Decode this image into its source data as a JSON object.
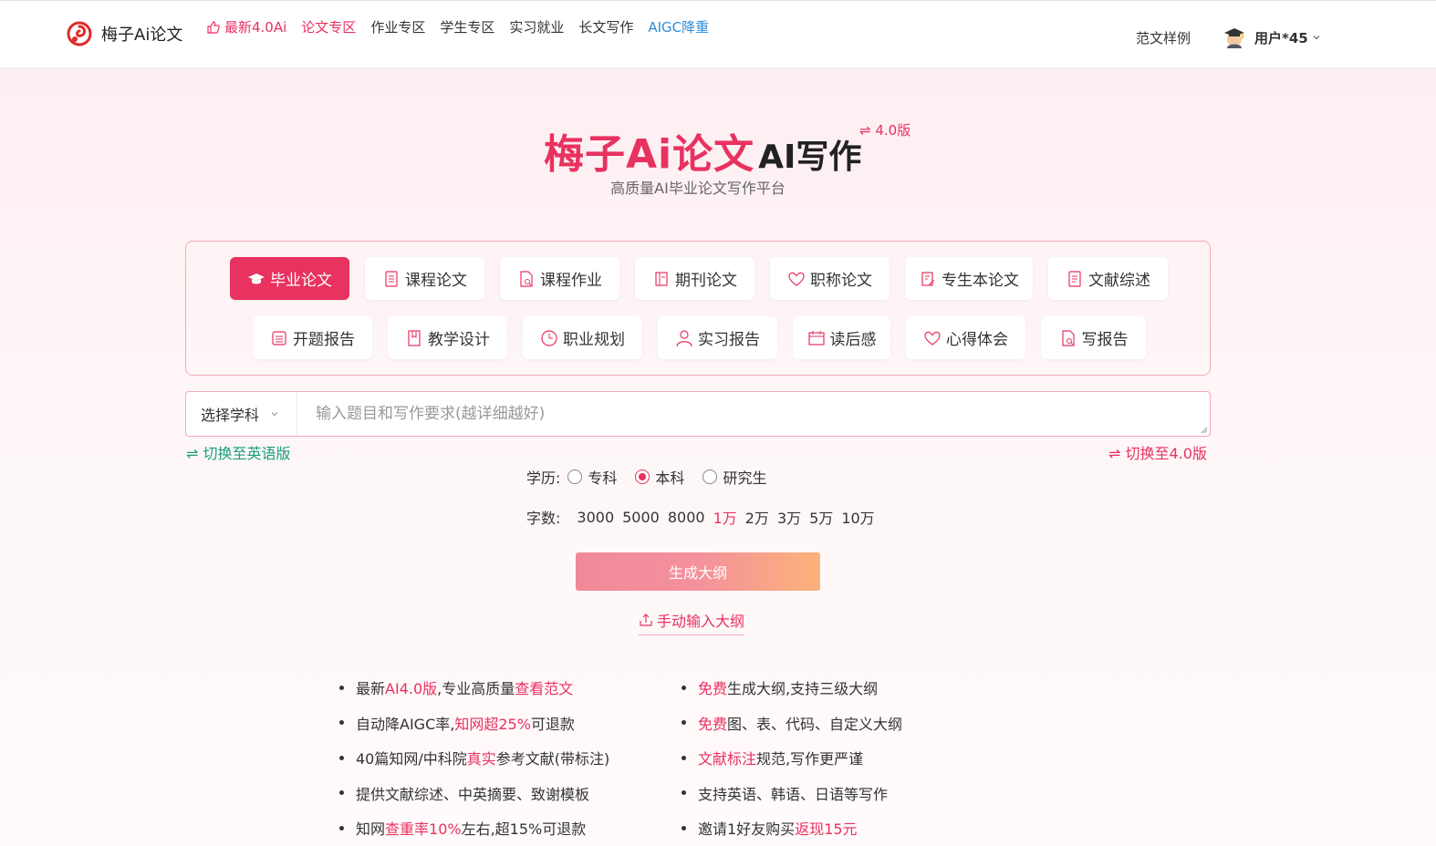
{
  "header": {
    "logo_text": "梅子Ai论文",
    "nav": [
      {
        "label": "最新4.0Ai",
        "style": "hot"
      },
      {
        "label": "论文专区",
        "style": "active"
      },
      {
        "label": "作业专区",
        "style": ""
      },
      {
        "label": "学生专区",
        "style": ""
      },
      {
        "label": "实习就业",
        "style": ""
      },
      {
        "label": "长文写作",
        "style": ""
      },
      {
        "label": "AIGC降重",
        "style": "aigc"
      }
    ],
    "sample_link": "范文样例",
    "user_name": "用户*45"
  },
  "hero": {
    "brand_pink": "梅子Ai论文",
    "brand_dark": "AI写作",
    "version_tag": "⇌ 4.0版",
    "subtitle": "高质量AI毕业论文写作平台"
  },
  "types": {
    "row1": [
      {
        "label": "毕业论文",
        "icon": "graduation-cap-icon",
        "selected": true
      },
      {
        "label": "课程论文",
        "icon": "document-icon"
      },
      {
        "label": "课程作业",
        "icon": "file-search-icon"
      },
      {
        "label": "期刊论文",
        "icon": "journal-icon"
      },
      {
        "label": "职称论文",
        "icon": "heart-icon"
      },
      {
        "label": "专生本论文",
        "icon": "file-edit-icon"
      },
      {
        "label": "文献综述",
        "icon": "document-icon"
      }
    ],
    "row2": [
      {
        "label": "开题报告",
        "icon": "report-icon"
      },
      {
        "label": "教学设计",
        "icon": "book-icon"
      },
      {
        "label": "职业规划",
        "icon": "clock-icon"
      },
      {
        "label": "实习报告",
        "icon": "person-icon"
      },
      {
        "label": "读后感",
        "icon": "calendar-icon"
      },
      {
        "label": "心得体会",
        "icon": "heart-icon"
      },
      {
        "label": "写报告",
        "icon": "file-search-icon"
      }
    ]
  },
  "input": {
    "subject_select": "选择学科",
    "placeholder": "输入题目和写作要求(越详细越好)",
    "value": ""
  },
  "switches": {
    "english": "⇌ 切换至英语版",
    "v40": "⇌ 切换至4.0版"
  },
  "education": {
    "label": "学历:",
    "options": [
      "专科",
      "本科",
      "研究生"
    ],
    "selected": "本科"
  },
  "word_count": {
    "label": "字数:",
    "options": [
      "3000",
      "5000",
      "8000",
      "1万",
      "2万",
      "3万",
      "5万",
      "10万"
    ],
    "selected": "1万"
  },
  "actions": {
    "generate": "生成大纲",
    "manual": "手动输入大纲"
  },
  "features": {
    "left": [
      [
        {
          "t": "最新",
          "h": false
        },
        {
          "t": "AI4.0版",
          "h": true
        },
        {
          "t": ",专业高质量 ",
          "h": false
        },
        {
          "t": "查看范文",
          "h": true
        }
      ],
      [
        {
          "t": "自动降AIGC率,",
          "h": false
        },
        {
          "t": "知网超25%",
          "h": true
        },
        {
          "t": "可退款",
          "h": false
        }
      ],
      [
        {
          "t": "40篇知网/中科院",
          "h": false
        },
        {
          "t": "真实",
          "h": true
        },
        {
          "t": "参考文献(带标注)",
          "h": false
        }
      ],
      [
        {
          "t": "提供文献综述、中英摘要、致谢模板",
          "h": false
        }
      ],
      [
        {
          "t": "知网",
          "h": false
        },
        {
          "t": "查重率10%",
          "h": true
        },
        {
          "t": "左右,超15%可退款",
          "h": false
        }
      ]
    ],
    "right": [
      [
        {
          "t": "免费",
          "h": true
        },
        {
          "t": "生成大纲,支持三级大纲",
          "h": false
        }
      ],
      [
        {
          "t": "免费",
          "h": true
        },
        {
          "t": "图、表、代码、自定义大纲",
          "h": false
        }
      ],
      [
        {
          "t": "文献标注",
          "h": true
        },
        {
          "t": "规范,写作更严谨",
          "h": false
        }
      ],
      [
        {
          "t": "支持英语、韩语、日语等写作",
          "h": false
        }
      ],
      [
        {
          "t": "邀请1好友购买",
          "h": false
        },
        {
          "t": "返现15元",
          "h": true
        }
      ]
    ]
  },
  "colors": {
    "accent": "#e8325f",
    "aigc": "#2d8cd8",
    "english_switch": "#1a9e7a"
  }
}
